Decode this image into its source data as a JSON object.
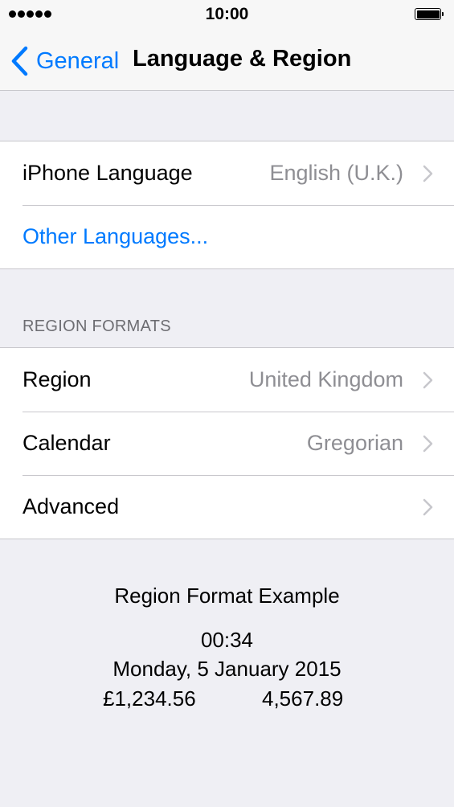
{
  "status_bar": {
    "time": "10:00",
    "signal_icon": "signal-dots-icon",
    "battery_icon": "battery-full-icon"
  },
  "nav": {
    "back_label": "General",
    "back_icon": "chevron-left-icon",
    "title": "Language & Region",
    "accent_color": "#007aff"
  },
  "language_group": {
    "iphone_language": {
      "label": "iPhone Language",
      "value": "English (U.K.)"
    },
    "other_languages": {
      "label": "Other Languages..."
    }
  },
  "region_formats": {
    "header": "REGION FORMATS",
    "region": {
      "label": "Region",
      "value": "United Kingdom"
    },
    "calendar": {
      "label": "Calendar",
      "value": "Gregorian"
    },
    "advanced": {
      "label": "Advanced"
    }
  },
  "example": {
    "title": "Region Format Example",
    "time": "00:34",
    "date": "Monday, 5 January 2015",
    "currency": "£1,234.56",
    "number": "4,567.89"
  }
}
